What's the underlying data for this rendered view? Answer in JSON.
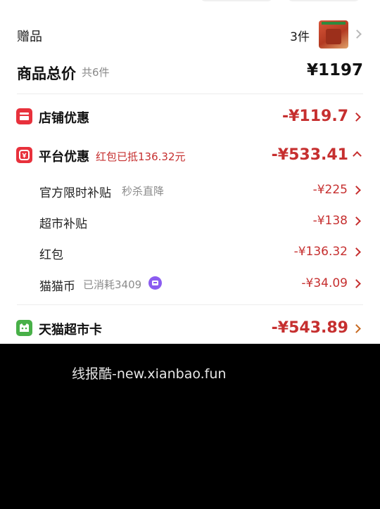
{
  "colors": {
    "price_red": "#c62f2f",
    "icon_red": "#e8313c",
    "icon_green": "#48b048",
    "coin_purple": "#8b5cf0",
    "background_dark": "#000000"
  },
  "gift": {
    "label": "赠品",
    "count": "3件"
  },
  "total": {
    "label": "商品总价",
    "count": "共6件",
    "value": "¥1197"
  },
  "store_discount": {
    "title": "店铺优惠",
    "amount": "-¥119.7",
    "icon": "storefront-icon"
  },
  "platform_discount": {
    "title": "平台优惠",
    "subtitle": "红包已抵136.32元",
    "amount": "-¥533.41",
    "icon": "coupon-icon",
    "items": [
      {
        "label": "官方限时补贴",
        "sub": "秒杀直降",
        "amount": "-¥225"
      },
      {
        "label": "超市补贴",
        "sub": "",
        "amount": "-¥138"
      },
      {
        "label": "红包",
        "sub": "",
        "amount": "-¥136.32"
      },
      {
        "label": "猫猫币",
        "sub": "已消耗3409",
        "amount": "-¥34.09"
      }
    ]
  },
  "tmall_card": {
    "title": "天猫超市卡",
    "amount": "-¥543.89",
    "icon": "tmall-cat-icon"
  },
  "watermark": "线报酷-new.xianbao.fun"
}
